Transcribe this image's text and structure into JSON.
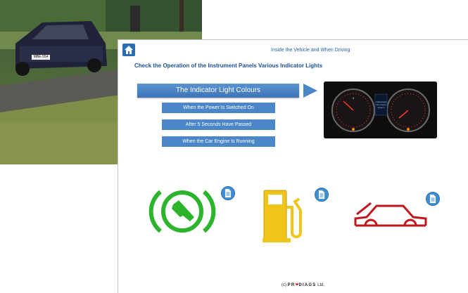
{
  "header": {
    "title": "Inside the Vehicle and When Driving"
  },
  "page": {
    "subtitle": "Check the Operation of the Instrument Panels Various Indicator Lights"
  },
  "buttons": {
    "main": "The Indicator Light Colours",
    "sub": [
      "When the Power Is Switched On",
      "After 5 Seconds Have Passed",
      "When the Car Engine Is Running"
    ]
  },
  "dashboard": {
    "display_text": "Volkswagen information System",
    "tacho_numbers": [
      "1",
      "2",
      "3",
      "4",
      "5",
      "6",
      "7"
    ]
  },
  "photo": {
    "license_plate": "MBE-554"
  },
  "indicators": [
    {
      "name": "electronic-parking-brake",
      "color": "#2db42d"
    },
    {
      "name": "fuel-level",
      "color": "#f0c419"
    },
    {
      "name": "bonnet-open",
      "color": "#c0161c"
    }
  ],
  "footer": {
    "prefix": "(c)",
    "brand_a": "PR",
    "brand_b": "DIAGS",
    "suffix": "Ltd."
  }
}
